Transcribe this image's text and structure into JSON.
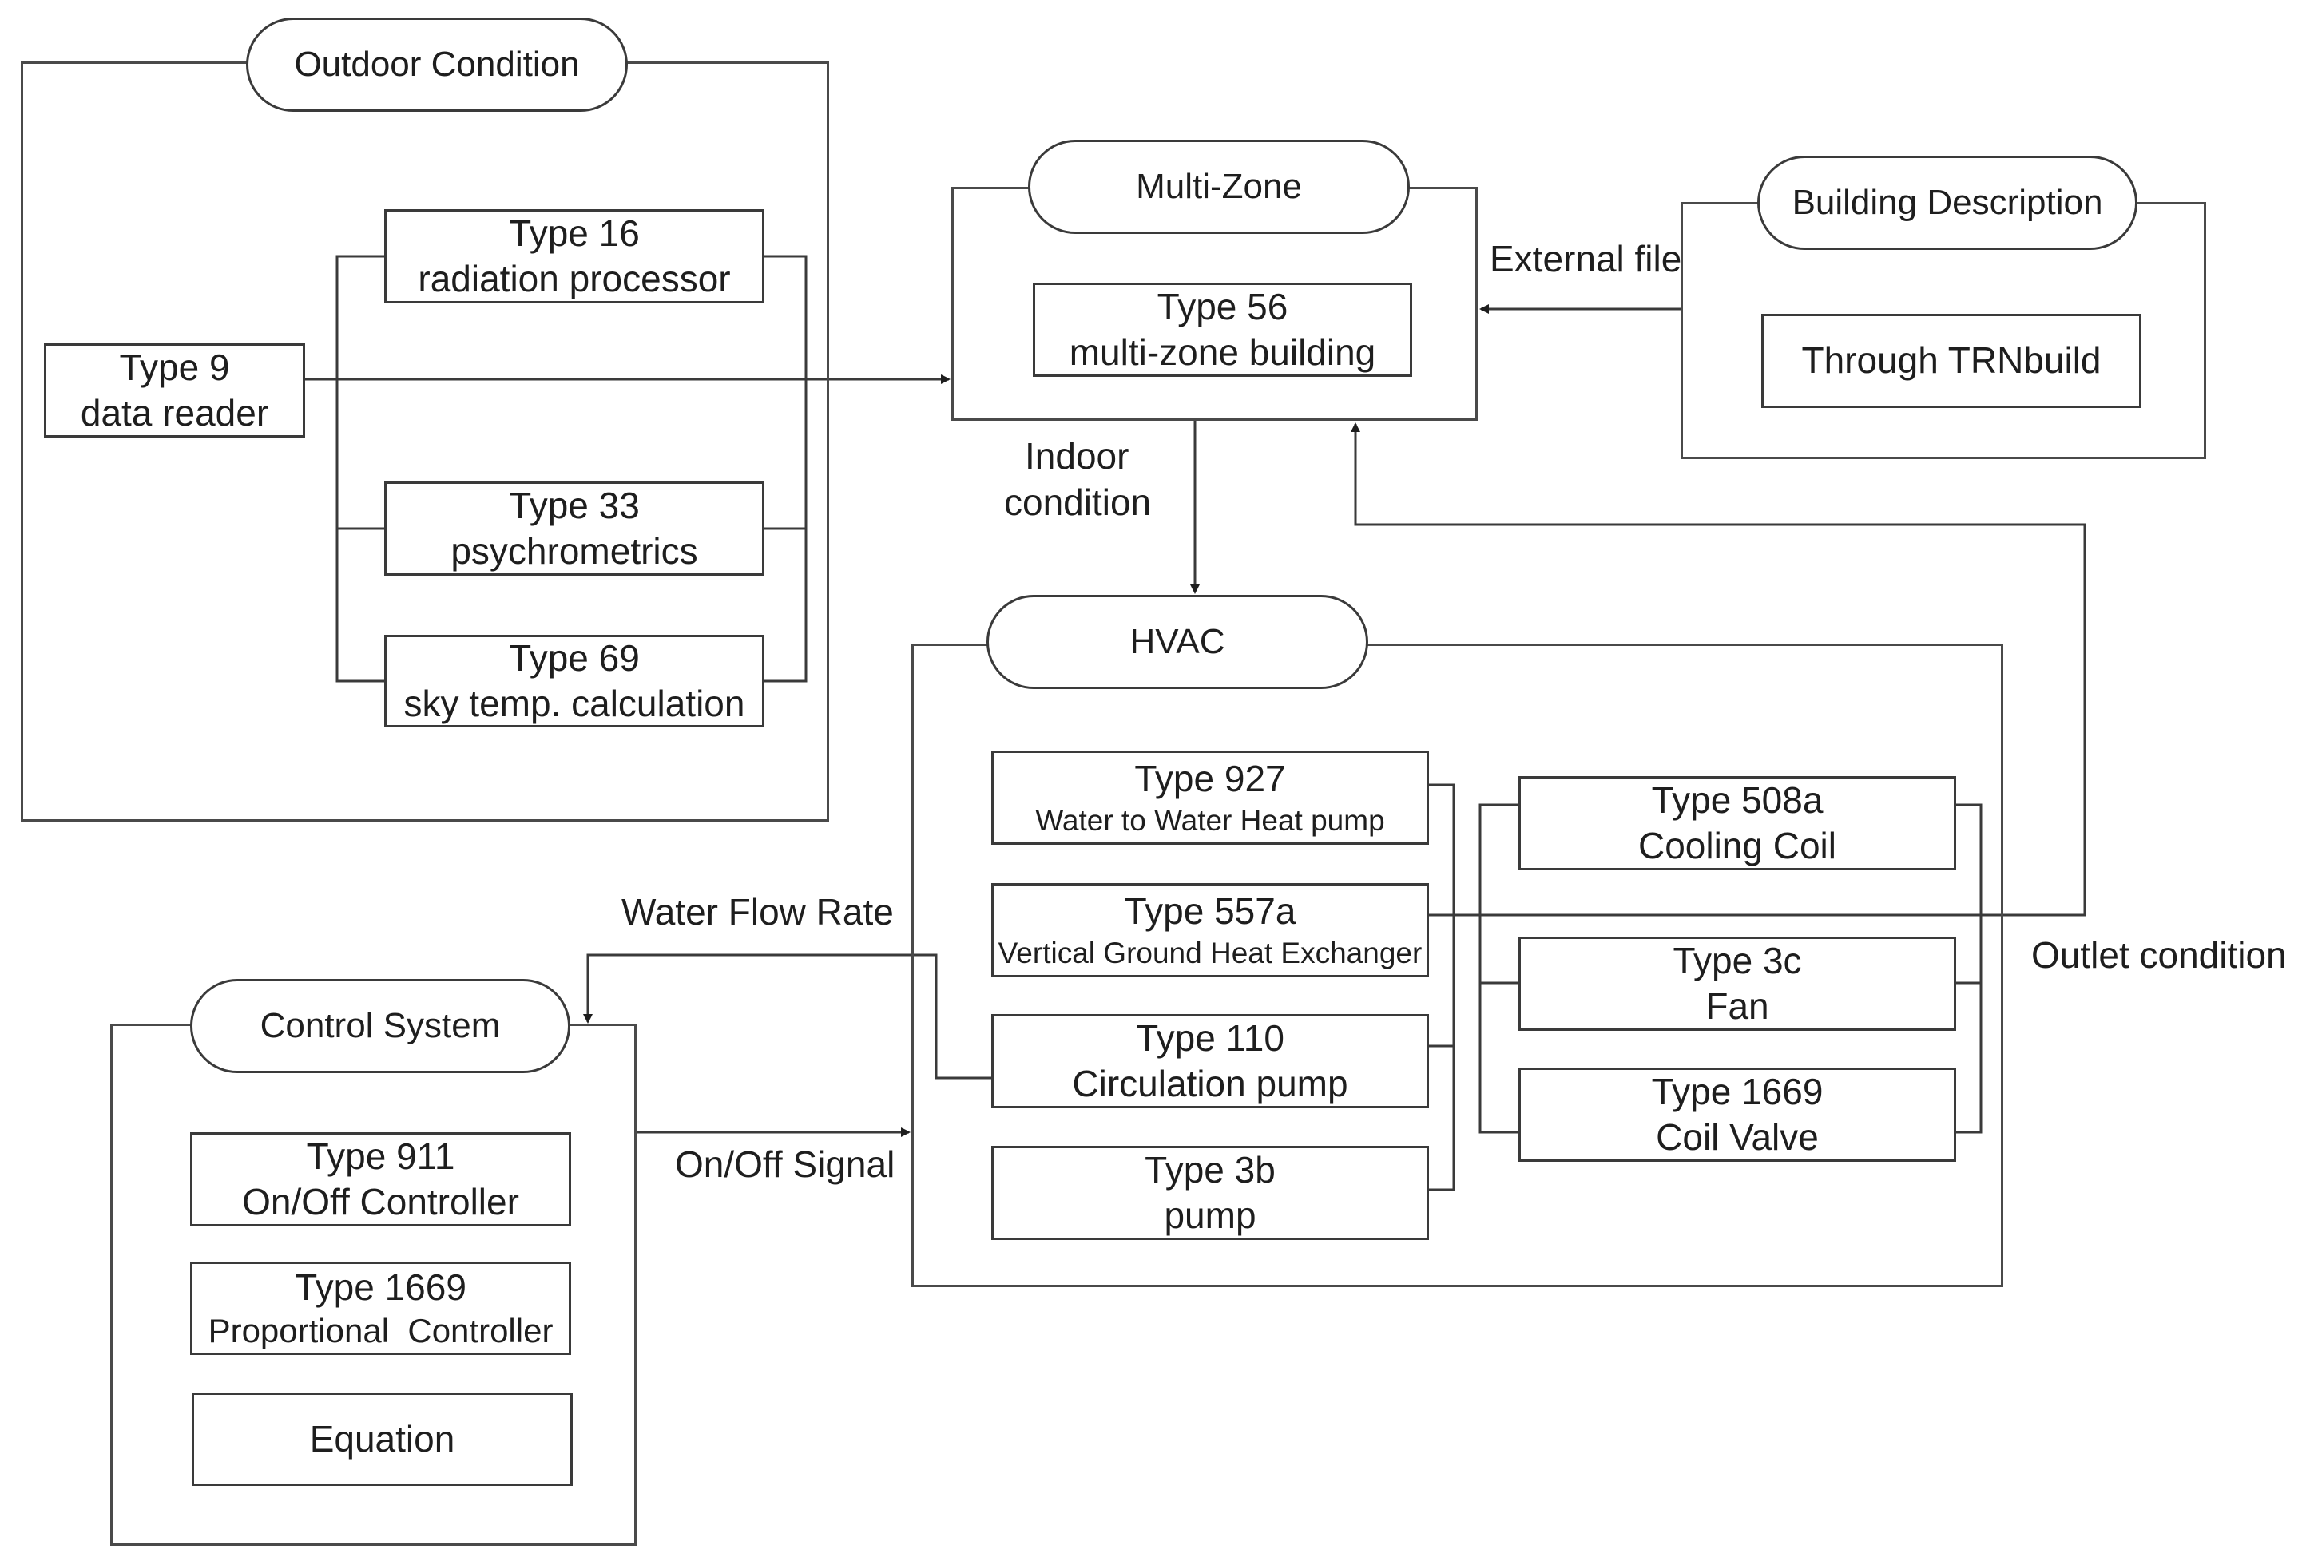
{
  "groups": {
    "outdoor": {
      "title": "Outdoor Condition",
      "components": [
        {
          "type": "Type 9",
          "desc": "data reader"
        },
        {
          "type": "Type 16",
          "desc": "radiation processor"
        },
        {
          "type": "Type 33",
          "desc": "psychrometrics"
        },
        {
          "type": "Type 69",
          "desc": "sky temp. calculation"
        }
      ]
    },
    "multizone": {
      "title": "Multi-Zone",
      "components": [
        {
          "type": "Type 56",
          "desc": "multi-zone building"
        }
      ]
    },
    "building": {
      "title": "Building Description",
      "components": [
        {
          "desc": "Through TRNbuild"
        }
      ]
    },
    "hvac": {
      "title": "HVAC",
      "components": [
        {
          "type": "Type 927",
          "desc": "Water to Water Heat pump"
        },
        {
          "type": "Type 557a",
          "desc": "Vertical Ground Heat Exchanger"
        },
        {
          "type": "Type 110",
          "desc": "Circulation pump"
        },
        {
          "type": "Type 3b",
          "desc": "pump"
        },
        {
          "type": "Type 508a",
          "desc": "Cooling Coil"
        },
        {
          "type": "Type 3c",
          "desc": "Fan"
        },
        {
          "type": "Type 1669",
          "desc": "Coil Valve"
        }
      ]
    },
    "control": {
      "title": "Control System",
      "components": [
        {
          "type": "Type 911",
          "desc": "On/Off Controller"
        },
        {
          "type": "Type 1669",
          "desc": "Proportional  Controller"
        },
        {
          "desc": "Equation"
        }
      ]
    }
  },
  "connections": {
    "external_file": "External file",
    "indoor_condition_line1": "Indoor",
    "indoor_condition_line2": "condition",
    "outlet_condition": "Outlet condition",
    "water_flow_rate": "Water Flow Rate",
    "on_off_signal": "On/Off Signal"
  },
  "colors": {
    "line": "#3a3a3a",
    "background": "#ffffff",
    "text": "#1e1e1e"
  }
}
